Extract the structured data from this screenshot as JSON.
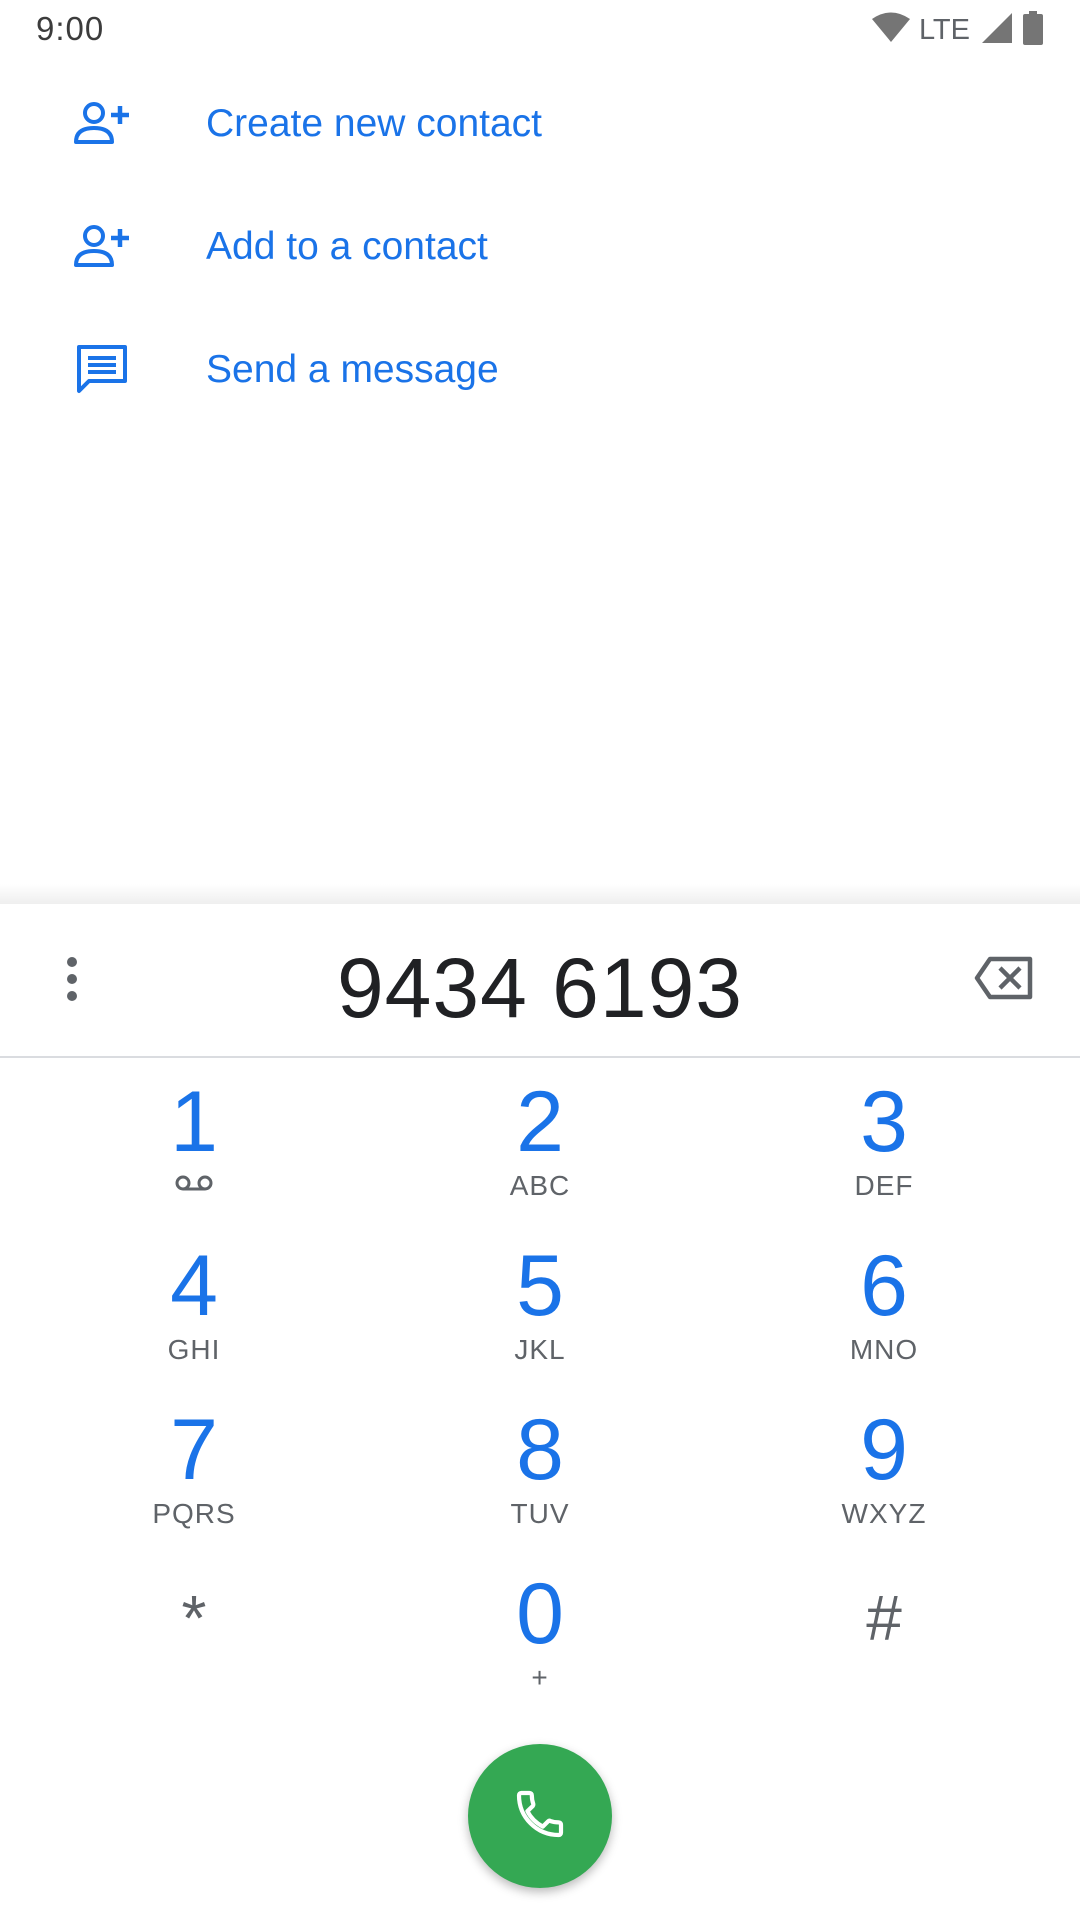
{
  "status_bar": {
    "time": "9:00",
    "network_label": "LTE",
    "icons": [
      "wifi-icon",
      "cell-signal-icon",
      "battery-icon"
    ]
  },
  "actions": [
    {
      "label": "Create new contact",
      "icon": "add-person-icon"
    },
    {
      "label": "Add to a contact",
      "icon": "add-person-icon"
    },
    {
      "label": "Send a message",
      "icon": "message-icon"
    }
  ],
  "dialpad": {
    "number": "9434 6193",
    "keys": [
      {
        "digit": "1",
        "letters": "",
        "icon": "voicemail-icon"
      },
      {
        "digit": "2",
        "letters": "ABC"
      },
      {
        "digit": "3",
        "letters": "DEF"
      },
      {
        "digit": "4",
        "letters": "GHI"
      },
      {
        "digit": "5",
        "letters": "JKL"
      },
      {
        "digit": "6",
        "letters": "MNO"
      },
      {
        "digit": "7",
        "letters": "PQRS"
      },
      {
        "digit": "8",
        "letters": "TUV"
      },
      {
        "digit": "9",
        "letters": "WXYZ"
      },
      {
        "digit": "*",
        "letters": ""
      },
      {
        "digit": "0",
        "letters": "+"
      },
      {
        "digit": "#",
        "letters": ""
      }
    ]
  },
  "colors": {
    "accent": "#1a73e8",
    "call_button": "#34a853",
    "text_primary": "#202124",
    "text_secondary": "#5f6368"
  }
}
